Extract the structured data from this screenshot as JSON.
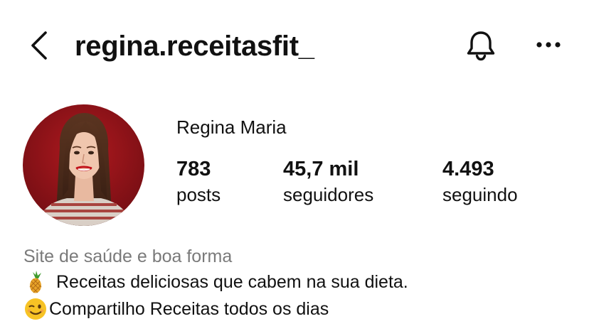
{
  "header": {
    "username": "regina.receitasfit_",
    "back_icon": "chevron-left-icon",
    "bell_icon": "bell-icon",
    "more_icon": "more-horizontal-icon"
  },
  "profile": {
    "display_name": "Regina Maria",
    "avatar_icon": "profile-photo",
    "stats": {
      "posts": {
        "value": "783",
        "label": "posts"
      },
      "followers": {
        "value": "45,7 mil",
        "label": "seguidores"
      },
      "following": {
        "value": "4.493",
        "label": "seguindo"
      }
    }
  },
  "bio": {
    "category": "Site de saúde e boa forma",
    "line1": {
      "emoji": "pineapple-emoji",
      "text": "Receitas deliciosas que cabem na sua dieta."
    },
    "line2": {
      "emoji": "winking-face-emoji",
      "text": "Compartilho Receitas todos os dias"
    }
  },
  "colors": {
    "text": "#111111",
    "muted": "#7a7a7a",
    "avatar_bg": "#8e1418"
  }
}
